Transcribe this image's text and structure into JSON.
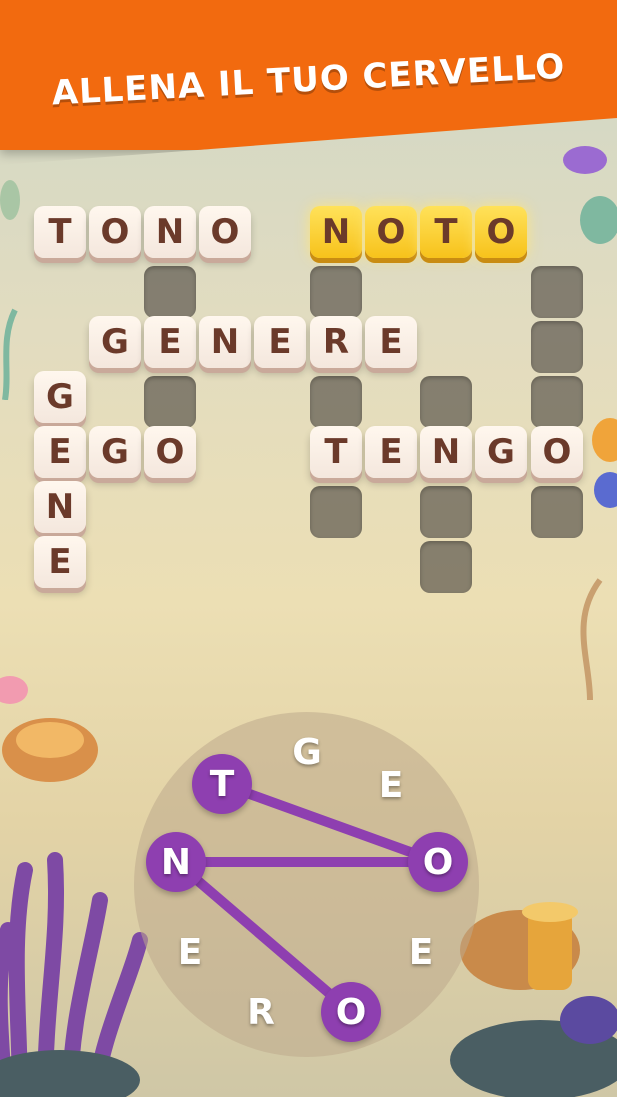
{
  "banner": {
    "title": "ALLENA IL TUO CERVELLO"
  },
  "words": {
    "tono": [
      "T",
      "O",
      "N",
      "O"
    ],
    "noto": [
      "N",
      "O",
      "T",
      "O"
    ],
    "genere": [
      "G",
      "E",
      "N",
      "E",
      "R",
      "E"
    ],
    "gene": [
      "G",
      "E",
      "N",
      "E"
    ],
    "ego": [
      "E",
      "G",
      "O"
    ],
    "tengo": [
      "T",
      "E",
      "N",
      "G",
      "O"
    ]
  },
  "wheel": {
    "letters": [
      "T",
      "G",
      "E",
      "O",
      "E",
      "O",
      "R",
      "E",
      "N"
    ],
    "selected": [
      "T",
      "O",
      "N",
      "O"
    ]
  },
  "colors": {
    "banner": "#f26a0f",
    "selection": "#8e3fb0",
    "highlight": "#f7c21b"
  }
}
